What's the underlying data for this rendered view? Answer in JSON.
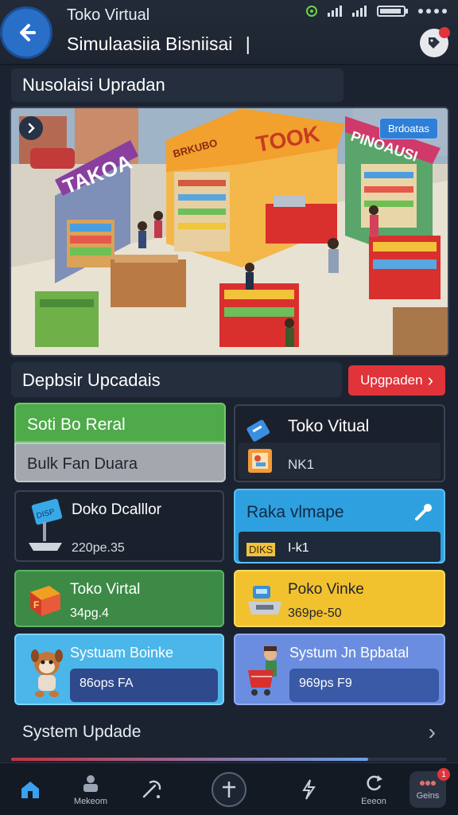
{
  "header": {
    "title": "Toko Virtual",
    "subtitle": "Simulaasiia Bisniisai",
    "cursor": "|"
  },
  "section_title": "Nusolaisi Upradan",
  "hero": {
    "badge": "Brdoatas",
    "signs": [
      "TAKOA",
      "TOOK",
      "PINOAUSI",
      "BRKUBO"
    ]
  },
  "updates": {
    "title": "Depbsir Upcadais",
    "upgrade_label": "Upgpaden",
    "upgrade_chevron": "›"
  },
  "cards": {
    "c1": {
      "title": "Soti Bo Reral",
      "subtitle": "Bulk Fan Duara"
    },
    "c2": {
      "title": "Toko Vitual",
      "value": "NK1"
    },
    "c3": {
      "title": "Doko Dcalllor",
      "value": "220pe.35"
    },
    "c4": {
      "title": "Raka vlmape",
      "tag": "DIKS",
      "value": "I-k1"
    },
    "c5": {
      "title": "Toko Virtal",
      "value": "34pg.4"
    },
    "c6": {
      "title": "Poko Vinke",
      "value": "369pe-50"
    },
    "c7": {
      "title": "Systuam Boinke",
      "value": "86ops FA"
    },
    "c8": {
      "title": "Systum Jn Bpbatal",
      "value": "969ps F9"
    }
  },
  "system_update": {
    "label": "System Updade",
    "chevron": "›"
  },
  "nav": {
    "items": [
      {
        "label": ""
      },
      {
        "label": "Mekeom"
      },
      {
        "label": ""
      },
      {
        "label": ""
      },
      {
        "label": ""
      },
      {
        "label": "Eeeon"
      },
      {
        "label": "Geins"
      }
    ],
    "badge": "1"
  },
  "colors": {
    "accent_red": "#e0333a",
    "accent_blue": "#2f7fd6",
    "bg": "#1c2330"
  }
}
